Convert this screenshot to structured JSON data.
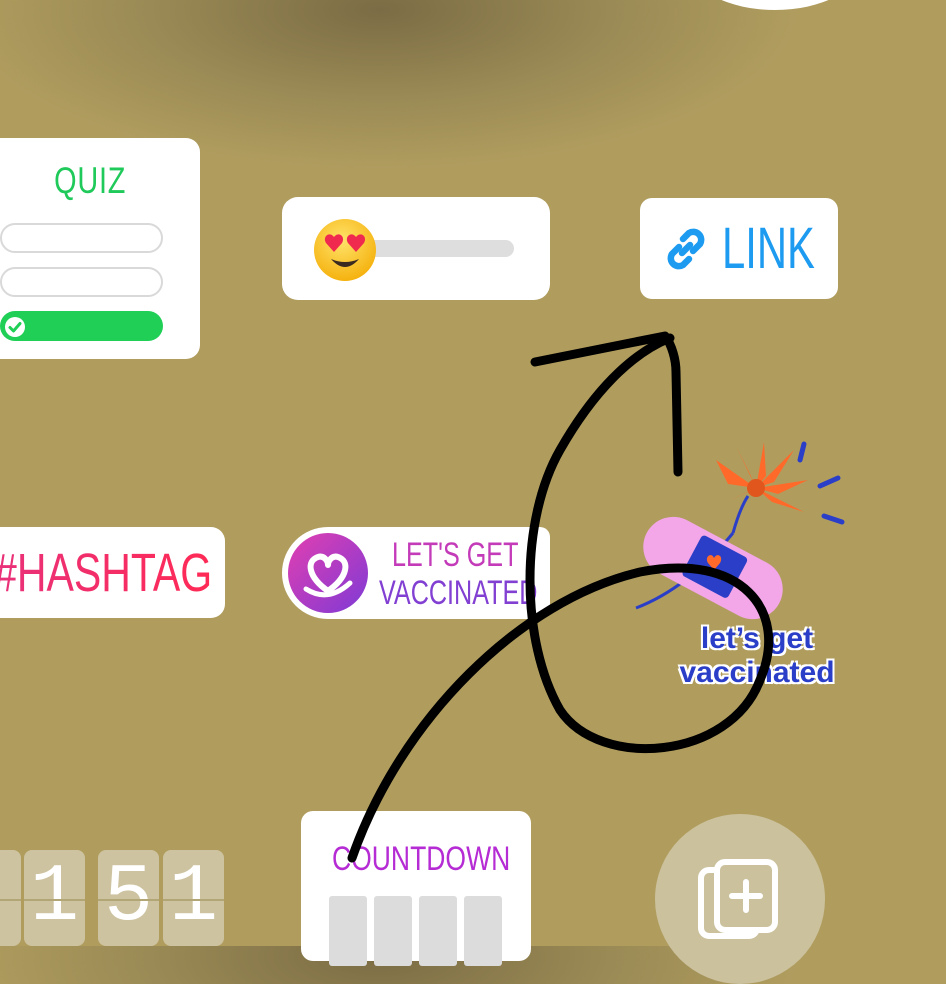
{
  "stickers": {
    "quiz": {
      "title": "QUIZ",
      "options": [
        {
          "selected": false
        },
        {
          "selected": false
        },
        {
          "selected": true
        }
      ]
    },
    "emoji_slider": {
      "emoji": "heart-eyes-emoji"
    },
    "link": {
      "label": "LINK",
      "icon": "link-icon",
      "color": "#1d9bf0"
    },
    "hashtag": {
      "label": "#HASHTAG",
      "color": "#ef2a6a"
    },
    "vaccine_tag": {
      "line1": "LET'S GET",
      "line2": "VACCINATED"
    },
    "vaccine_art": {
      "line1": "let’s get",
      "line2": "vaccinated"
    },
    "countdown": {
      "label": "COUNTDOWN"
    },
    "time_digits": [
      "1",
      "5",
      "1"
    ]
  },
  "actions": {
    "new_sticker_icon": "add-sticker-icon"
  }
}
